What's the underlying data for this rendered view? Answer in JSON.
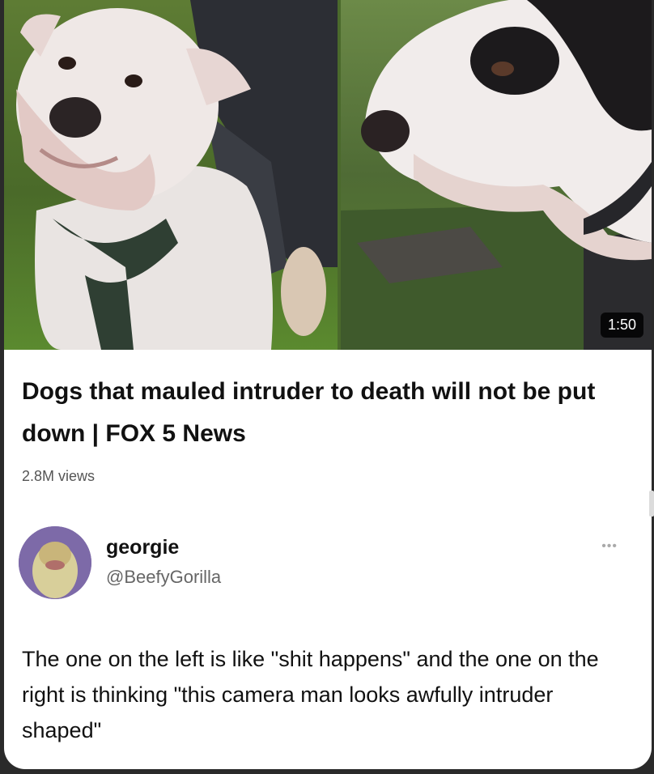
{
  "video": {
    "duration": "1:50",
    "title": "Dogs that mauled intruder to death will not be put down | FOX 5 News",
    "views": "2.8M views"
  },
  "post": {
    "author_name": "georgie",
    "author_handle": "@BeefyGorilla",
    "more_icon": "ellipsis-icon",
    "more_glyph": "•••",
    "text": "The one on the left is like \"shit happens\" and the one on the right is thinking \"this camera man looks awfully intruder shaped\""
  }
}
